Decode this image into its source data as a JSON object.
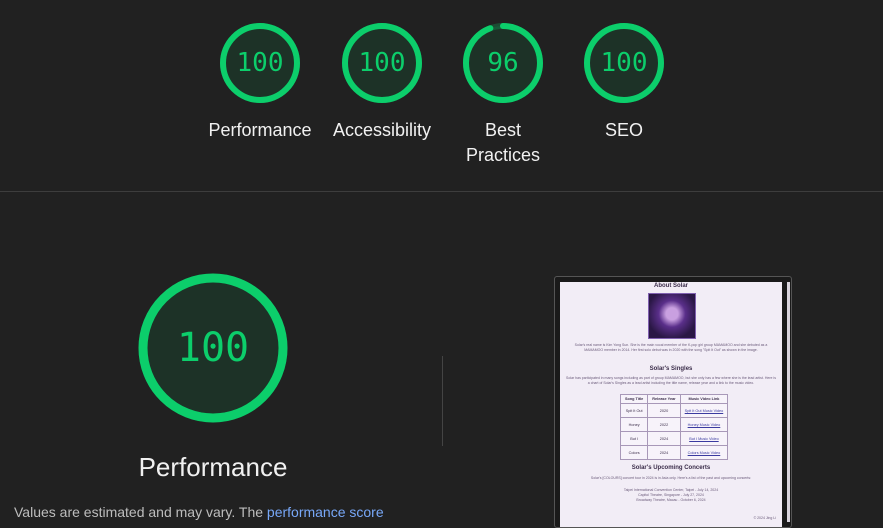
{
  "colors": {
    "pass": "#0cce6b",
    "pass_bg": "#1d3227",
    "text": "#e8e8e8",
    "link": "#78a8f8"
  },
  "categories": [
    {
      "label": "Performance",
      "score": "100",
      "value": 100
    },
    {
      "label": "Accessibility",
      "score": "100",
      "value": 100
    },
    {
      "label": "Best\nPractices",
      "score": "96",
      "value": 96
    },
    {
      "label": "SEO",
      "score": "100",
      "value": 100
    }
  ],
  "main": {
    "score": "100",
    "value": 100,
    "title": "Performance",
    "note_prefix": "Values are estimated and may vary. The ",
    "note_link": "performance score"
  },
  "thumbnail": {
    "about_title": "About Solar",
    "about_text": "Solar's real name is Kim Yong Sun. She is the main vocal member of the K-pop girl group MAMAMOO and she debuted as a MAMAMOO member in 2014. Her first solo debut was in 2020 with the song \"Spit It Out\" as shown in the image.",
    "singles_title": "Solar's Singles",
    "singles_text": "Solar has participated in many songs including as part of group MAMAMOO, but she only has a few where she is the lead artist. Here is a chart of Solar's Singles as a lead artist including the title name, release year and a link to the music video.",
    "table_headers": [
      "Song Title",
      "Release Year",
      "Music Video Link"
    ],
    "table_rows": [
      [
        "Spit It Out",
        "2020",
        "Spit It Out Music Video"
      ],
      [
        "Honey",
        "2022",
        "Honey Music Video"
      ],
      [
        "But I",
        "2024",
        "But I Music Video"
      ],
      [
        "Colors",
        "2024",
        "Colors Music Video"
      ]
    ],
    "concerts_title": "Solar's Upcoming Concerts",
    "concerts_text": "Solar's [COLOURS] concert tour in 2024 is in Asia only. Here's a list of the past and upcoming concerts:",
    "concerts_list": [
      "Taipei International Convention Center, Taipei - July 14, 2024",
      "Capitol Theatre, Singapore - July 27, 2024",
      "Broadway Theatre, Macau - October 6, 2024"
    ],
    "footer": "© 2024 Jing Li"
  }
}
